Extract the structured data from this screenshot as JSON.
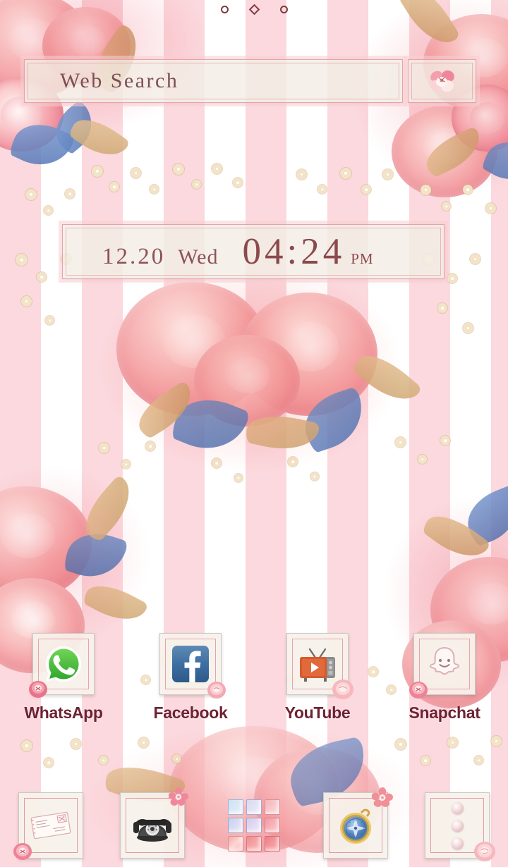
{
  "theme": {
    "name": "Pink Floral Stripes",
    "accent_pink": "#e8a3ad",
    "label_color": "#6e2233",
    "clock_color": "#8b4a4d",
    "stripe_pink": "#fbd9de",
    "panel_cream": "#f3eee5"
  },
  "page_indicator": {
    "dots": [
      {
        "shape": "circle",
        "active": false
      },
      {
        "shape": "diamond",
        "active": true
      },
      {
        "shape": "circle",
        "active": false
      }
    ]
  },
  "search": {
    "label": "Web Search",
    "placeholder": "Web Search",
    "button_icon": "flower-icon"
  },
  "clock_widget": {
    "date": "12.20",
    "weekday": "Wed",
    "time": "04:24",
    "meridiem": "PM"
  },
  "apps": [
    {
      "label": "WhatsApp",
      "icon": "whatsapp-icon"
    },
    {
      "label": "Facebook",
      "icon": "facebook-icon"
    },
    {
      "label": "YouTube",
      "icon": "youtube-tv-icon"
    },
    {
      "label": "Snapchat",
      "icon": "snapchat-ghost-icon"
    }
  ],
  "dock": [
    {
      "name": "Messages",
      "icon": "envelope-icon"
    },
    {
      "name": "Phone",
      "icon": "rotary-phone-icon"
    },
    {
      "name": "App Drawer",
      "icon": "app-drawer-grid-icon"
    },
    {
      "name": "Browser",
      "icon": "compass-icon"
    },
    {
      "name": "Menu",
      "icon": "three-dots-icon"
    }
  ]
}
